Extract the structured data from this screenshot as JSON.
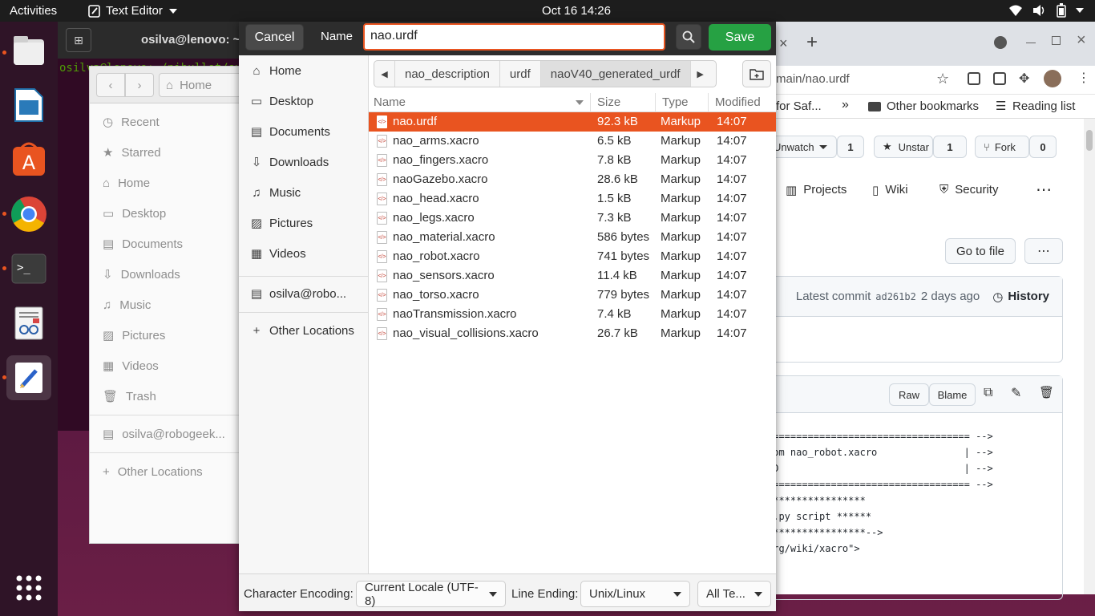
{
  "topbar": {
    "activities": "Activities",
    "app_menu": "Text Editor",
    "clock": "Oct 16  14:26"
  },
  "terminal": {
    "title": "osilva@lenovo: ~/",
    "line": "osilva@lenovo:~/nibullet/over"
  },
  "nautilus": {
    "home_label": "Home",
    "sidebar": [
      "Recent",
      "Starred",
      "Home",
      "Desktop",
      "Documents",
      "Downloads",
      "Music",
      "Pictures",
      "Videos",
      "Trash"
    ],
    "network": "osilva@robogeek...",
    "other": "Other Locations"
  },
  "chrome": {
    "url": "main/nao.urdf",
    "bookmarks": {
      "saf": "for Saf...",
      "other": "Other bookmarks",
      "reading": "Reading list"
    },
    "unwatch": "Unwatch",
    "unwatch_count": "1",
    "unstar": "Unstar",
    "star_count": "1",
    "fork": "Fork",
    "fork_count": "0",
    "tabs": {
      "projects": "Projects",
      "wiki": "Wiki",
      "security": "Security"
    },
    "go_to_file": "Go to file",
    "latest_commit": "Latest commit",
    "commit_hash": "ad261b2",
    "commit_age": "2 days ago",
    "history": "History",
    "raw": "Raw",
    "blame": "Blame",
    "code_lines": [
      "=================================== -->",
      "rom nao_robot.xacro               | -->",
      "ED                                | -->",
      "=================================== -->",
      "*****************",
      "f.py script ******",
      "*****************-->",
      "org/wiki/xacro\">"
    ]
  },
  "dialog": {
    "cancel": "Cancel",
    "name_label": "Name",
    "filename": "nao.urdf",
    "save": "Save",
    "places": [
      "Home",
      "Desktop",
      "Documents",
      "Downloads",
      "Music",
      "Pictures",
      "Videos"
    ],
    "network": "osilva@robo...",
    "other_locations": "Other Locations",
    "path": [
      "nao_description",
      "urdf",
      "naoV40_generated_urdf"
    ],
    "columns": {
      "name": "Name",
      "size": "Size",
      "type": "Type",
      "modified": "Modified"
    },
    "files": [
      {
        "name": "nao.urdf",
        "size": "92.3 kB",
        "type": "Markup",
        "modified": "14:07"
      },
      {
        "name": "nao_arms.xacro",
        "size": "6.5 kB",
        "type": "Markup",
        "modified": "14:07"
      },
      {
        "name": "nao_fingers.xacro",
        "size": "7.8 kB",
        "type": "Markup",
        "modified": "14:07"
      },
      {
        "name": "naoGazebo.xacro",
        "size": "28.6 kB",
        "type": "Markup",
        "modified": "14:07"
      },
      {
        "name": "nao_head.xacro",
        "size": "1.5 kB",
        "type": "Markup",
        "modified": "14:07"
      },
      {
        "name": "nao_legs.xacro",
        "size": "7.3 kB",
        "type": "Markup",
        "modified": "14:07"
      },
      {
        "name": "nao_material.xacro",
        "size": "586 bytes",
        "type": "Markup",
        "modified": "14:07"
      },
      {
        "name": "nao_robot.xacro",
        "size": "741 bytes",
        "type": "Markup",
        "modified": "14:07"
      },
      {
        "name": "nao_sensors.xacro",
        "size": "11.4 kB",
        "type": "Markup",
        "modified": "14:07"
      },
      {
        "name": "nao_torso.xacro",
        "size": "779 bytes",
        "type": "Markup",
        "modified": "14:07"
      },
      {
        "name": "naoTransmission.xacro",
        "size": "7.4 kB",
        "type": "Markup",
        "modified": "14:07"
      },
      {
        "name": "nao_visual_collisions.xacro",
        "size": "26.7 kB",
        "type": "Markup",
        "modified": "14:07"
      }
    ],
    "encoding_label": "Character Encoding:",
    "encoding_value": "Current Locale (UTF-8)",
    "line_ending_label": "Line Ending:",
    "line_ending_value": "Unix/Linux",
    "filter_value": "All Te..."
  },
  "colors": {
    "accent": "#e95420",
    "save_green": "#26a143"
  }
}
